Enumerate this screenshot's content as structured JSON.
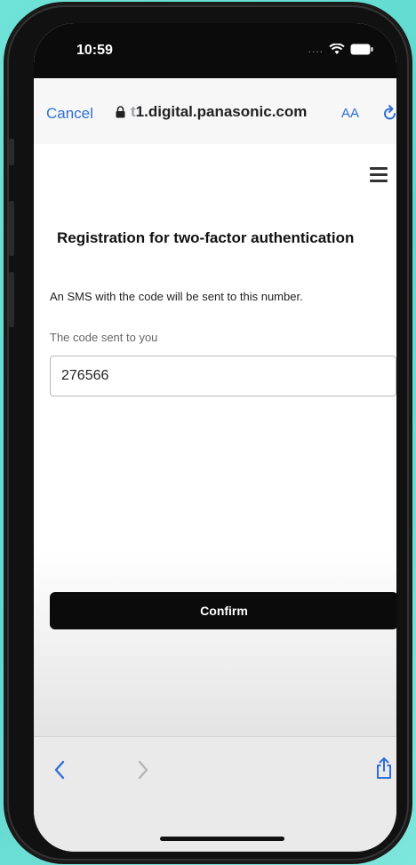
{
  "status_bar": {
    "time": "10:59",
    "signal": "...."
  },
  "browser": {
    "cancel_label": "Cancel",
    "url_prefix": "t",
    "url_domain": "1.digital.panasonic.com",
    "text_size_label": "AA"
  },
  "page": {
    "title": "Registration for two-factor authentication",
    "info": "An SMS with the code will be sent to this number.",
    "code_label": "The code sent to you",
    "code_value": "276566",
    "confirm_label": "Confirm"
  },
  "icons": {
    "lock": "lock-icon",
    "reload": "reload-icon",
    "menu": "hamburger-menu-icon",
    "back": "chevron-left-icon",
    "forward": "chevron-right-icon",
    "share": "share-icon"
  },
  "colors": {
    "link": "#2f6fd6",
    "button": "#0b0b0b",
    "background": "#6fe3d6"
  }
}
